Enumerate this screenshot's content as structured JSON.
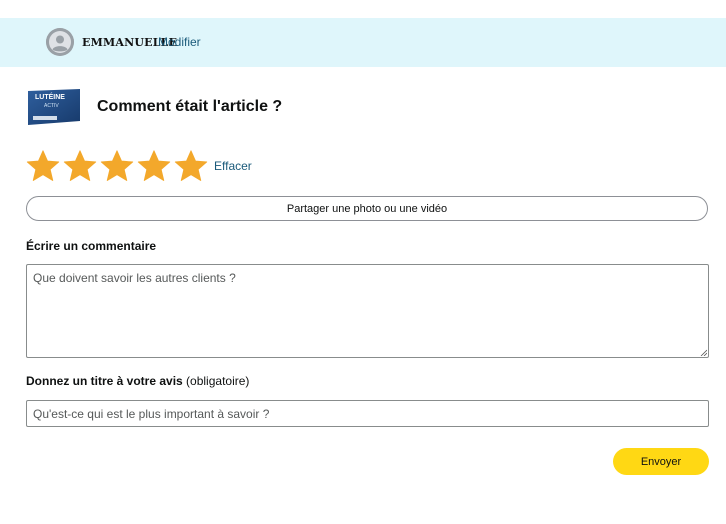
{
  "user": {
    "name": "EMMANUELLE",
    "modify_label": "Modifier"
  },
  "product": {
    "thumb_text_top": "LUTÉINE",
    "thumb_text_bottom": "ACTIV"
  },
  "review": {
    "question": "Comment était l'article ?",
    "rating": 5,
    "max_rating": 5,
    "star_color": "#f3a82b",
    "clear_label": "Effacer",
    "share_label": "Partager une photo ou une vidéo",
    "comment_label": "Écrire un commentaire",
    "comment_placeholder": "Que doivent savoir les autres clients ?",
    "title_label": "Donnez un titre à votre avis",
    "title_required": "(obligatoire)",
    "title_placeholder": "Qu'est-ce qui est le plus important à savoir ?",
    "submit_label": "Envoyer"
  },
  "colors": {
    "user_bar_bg": "#dff6fb",
    "link": "#1a5a7a",
    "submit_bg": "#ffd814"
  }
}
